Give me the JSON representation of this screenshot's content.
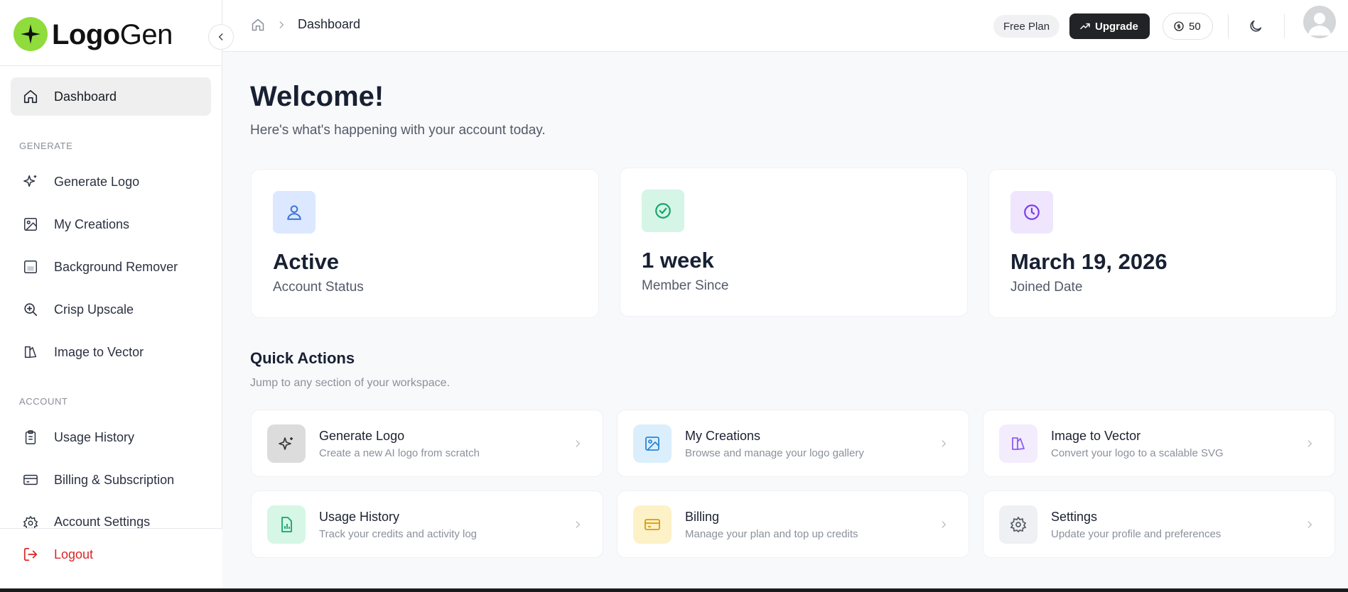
{
  "brand": {
    "logo_bold": "Logo",
    "logo_light": "Gen"
  },
  "sidebar": {
    "dashboard": "Dashboard",
    "generate_section": "GENERATE",
    "generate_items": [
      "Generate Logo",
      "My Creations",
      "Background Remover",
      "Crisp Upscale",
      "Image to Vector"
    ],
    "account_section": "ACCOUNT",
    "account_items": [
      "Usage History",
      "Billing & Subscription",
      "Account Settings"
    ],
    "logout": "Logout"
  },
  "topbar": {
    "breadcrumb": "Dashboard",
    "plan": "Free Plan",
    "upgrade": "Upgrade",
    "credits": "50"
  },
  "main": {
    "welcome": "Welcome!",
    "subtitle": "Here's what's happening with your account today.",
    "stats": [
      {
        "value": "Active",
        "label": "Account Status",
        "icon": "user-icon",
        "bg": "#dbe8ff",
        "fg": "#3b6fd8"
      },
      {
        "value": "1 week",
        "label": "Member Since",
        "icon": "check-circle-icon",
        "bg": "#d5f5e6",
        "fg": "#16a36a"
      },
      {
        "value": "March 19, 2026",
        "label": "Joined Date",
        "icon": "clock-icon",
        "bg": "#efe6fd",
        "fg": "#7c3aed"
      }
    ],
    "quick_actions_title": "Quick Actions",
    "quick_actions_subtitle": "Jump to any section of your workspace.",
    "quick_actions": [
      {
        "name": "Generate Logo",
        "desc": "Create a new AI logo from scratch",
        "icon": "sparkles-icon",
        "bg": "#dcdcdc",
        "fg": "#333"
      },
      {
        "name": "My Creations",
        "desc": "Browse and manage your logo gallery",
        "icon": "image-icon",
        "bg": "#dbeefc",
        "fg": "#2b86d4"
      },
      {
        "name": "Image to Vector",
        "desc": "Convert your logo to a scalable SVG",
        "icon": "vector-icon",
        "bg": "#f3ecfd",
        "fg": "#8b5cf6"
      },
      {
        "name": "Usage History",
        "desc": "Track your credits and activity log",
        "icon": "chart-file-icon",
        "bg": "#d6f6e6",
        "fg": "#16a36a"
      },
      {
        "name": "Billing",
        "desc": "Manage your plan and top up credits",
        "icon": "credit-card-icon",
        "bg": "#fdf1c8",
        "fg": "#d99b06"
      },
      {
        "name": "Settings",
        "desc": "Update your profile and preferences",
        "icon": "gear-icon",
        "bg": "#eef0f3",
        "fg": "#555b66"
      }
    ]
  }
}
